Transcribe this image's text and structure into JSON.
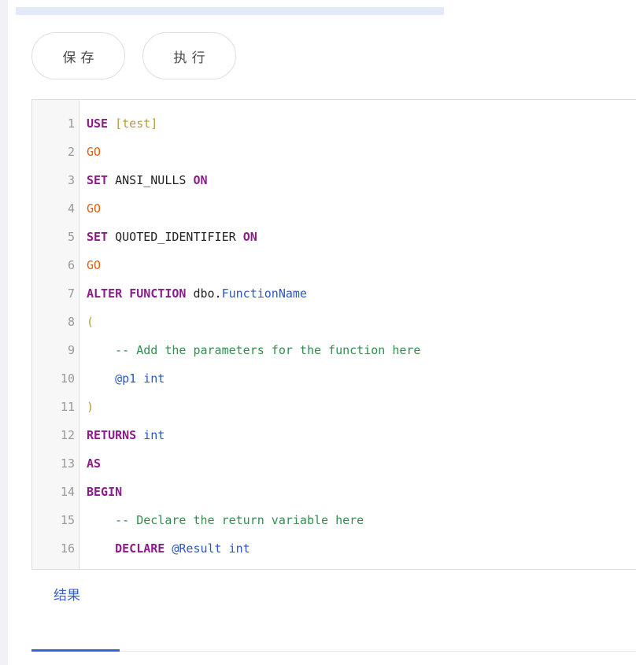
{
  "toolbar": {
    "save_label": "保存",
    "run_label": "执行"
  },
  "editor": {
    "language": "sql",
    "lines": [
      {
        "num": "1",
        "tokens": [
          {
            "t": "USE",
            "c": "kw"
          },
          {
            "t": " ",
            "c": "pl"
          },
          {
            "t": "[test]",
            "c": "br"
          }
        ]
      },
      {
        "num": "2",
        "tokens": [
          {
            "t": "GO",
            "c": "go"
          }
        ]
      },
      {
        "num": "3",
        "tokens": [
          {
            "t": "SET",
            "c": "kw"
          },
          {
            "t": " ANSI_NULLS ",
            "c": "pl"
          },
          {
            "t": "ON",
            "c": "kw"
          }
        ]
      },
      {
        "num": "4",
        "tokens": [
          {
            "t": "GO",
            "c": "go"
          }
        ]
      },
      {
        "num": "5",
        "tokens": [
          {
            "t": "SET",
            "c": "kw"
          },
          {
            "t": " QUOTED_IDENTIFIER ",
            "c": "pl"
          },
          {
            "t": "ON",
            "c": "kw"
          }
        ]
      },
      {
        "num": "6",
        "tokens": [
          {
            "t": "GO",
            "c": "go"
          }
        ]
      },
      {
        "num": "7",
        "tokens": [
          {
            "t": "ALTER",
            "c": "kw"
          },
          {
            "t": " ",
            "c": "pl"
          },
          {
            "t": "FUNCTION",
            "c": "kw"
          },
          {
            "t": " dbo.",
            "c": "pl"
          },
          {
            "t": "FunctionName",
            "c": "fn"
          }
        ]
      },
      {
        "num": "8",
        "tokens": [
          {
            "t": "(",
            "c": "br"
          }
        ]
      },
      {
        "num": "9",
        "tokens": [
          {
            "t": "    ",
            "c": "pl"
          },
          {
            "t": "-- Add the parameters for the function here",
            "c": "cm"
          }
        ]
      },
      {
        "num": "10",
        "tokens": [
          {
            "t": "    ",
            "c": "pl"
          },
          {
            "t": "@p1",
            "c": "var"
          },
          {
            "t": " ",
            "c": "pl"
          },
          {
            "t": "int",
            "c": "typ"
          }
        ]
      },
      {
        "num": "11",
        "tokens": [
          {
            "t": ")",
            "c": "br"
          }
        ]
      },
      {
        "num": "12",
        "tokens": [
          {
            "t": "RETURNS",
            "c": "kw"
          },
          {
            "t": " ",
            "c": "pl"
          },
          {
            "t": "int",
            "c": "typ"
          }
        ]
      },
      {
        "num": "13",
        "tokens": [
          {
            "t": "AS",
            "c": "kw"
          }
        ]
      },
      {
        "num": "14",
        "tokens": [
          {
            "t": "BEGIN",
            "c": "kw"
          }
        ]
      },
      {
        "num": "15",
        "tokens": [
          {
            "t": "    ",
            "c": "pl"
          },
          {
            "t": "-- Declare the return variable here",
            "c": "cm"
          }
        ]
      },
      {
        "num": "16",
        "tokens": [
          {
            "t": "    ",
            "c": "pl"
          },
          {
            "t": "DECLARE",
            "c": "kw"
          },
          {
            "t": " ",
            "c": "pl"
          },
          {
            "t": "@Result",
            "c": "var"
          },
          {
            "t": " ",
            "c": "pl"
          },
          {
            "t": "int",
            "c": "typ"
          }
        ]
      }
    ]
  },
  "results_tab": {
    "label": "结果",
    "active": true
  },
  "colors": {
    "accent": "#3a62d6",
    "keyword": "#8b1d8b",
    "go_keyword": "#e0600f",
    "bracket": "#b89b3a",
    "identifier": "#2a57c9",
    "comment": "#2f8f4f",
    "line_number": "#999999"
  }
}
